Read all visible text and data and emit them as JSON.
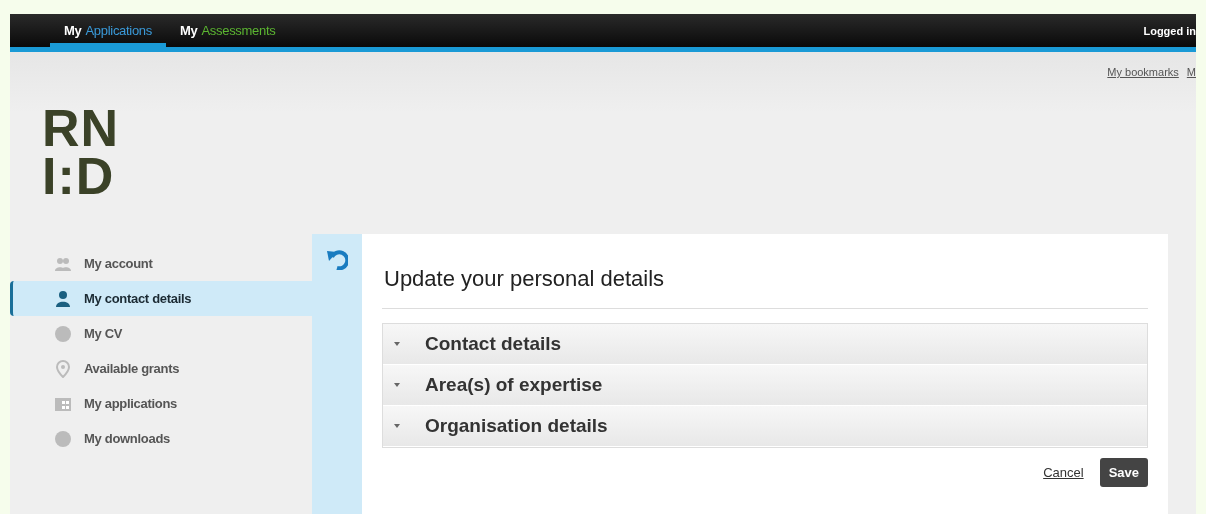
{
  "top_nav": {
    "tabs": [
      {
        "prefix": "My",
        "label": "Applications",
        "selected": true
      },
      {
        "prefix": "My",
        "label": "Assessments",
        "selected": false
      }
    ],
    "login_text": "Logged in"
  },
  "header": {
    "links": [
      "My bookmarks",
      "M"
    ],
    "logo_lines": [
      "RN",
      "I:D"
    ]
  },
  "sidebar": {
    "items": [
      {
        "label": "My account",
        "kind": "people",
        "selected": false
      },
      {
        "label": "My contact details",
        "kind": "person",
        "selected": true
      },
      {
        "label": "My CV",
        "kind": "blob",
        "selected": false
      },
      {
        "label": "Available grants",
        "kind": "pin",
        "selected": false
      },
      {
        "label": "My applications",
        "kind": "grid",
        "selected": false
      },
      {
        "label": "My downloads",
        "kind": "blob",
        "selected": false
      }
    ]
  },
  "main": {
    "title": "Update your personal details",
    "sections": [
      {
        "label": "Contact details",
        "expanded": false
      },
      {
        "label": "Area(s) of expertise",
        "expanded": false
      },
      {
        "label": "Organisation details",
        "expanded": false
      }
    ],
    "cancel": "Cancel",
    "save": "Save"
  }
}
